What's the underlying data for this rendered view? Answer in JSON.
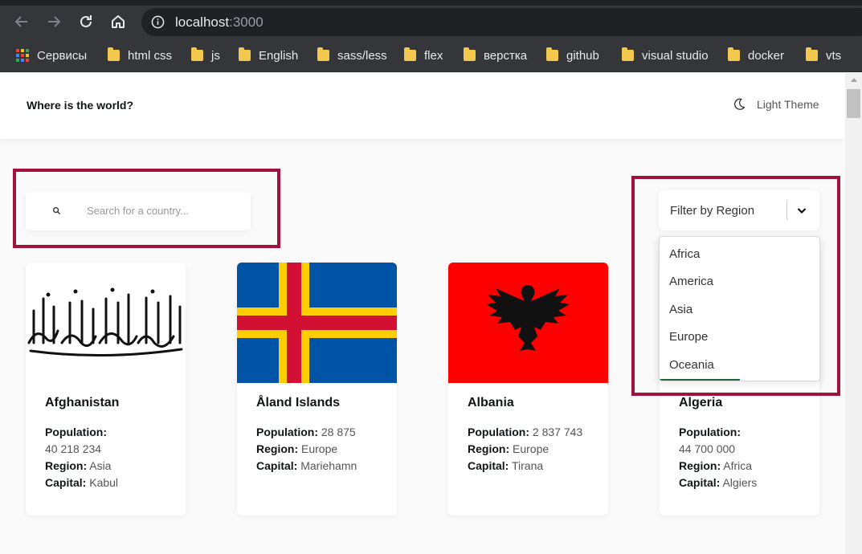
{
  "browser": {
    "url_host": "localhost",
    "url_port": ":3000",
    "bookmarks": [
      {
        "label": "Сервисы",
        "icon": "apps-grid-icon"
      },
      {
        "label": "html css",
        "icon": "folder-icon"
      },
      {
        "label": "js",
        "icon": "folder-icon"
      },
      {
        "label": "English",
        "icon": "folder-icon"
      },
      {
        "label": "sass/less",
        "icon": "folder-icon"
      },
      {
        "label": "flex",
        "icon": "folder-icon"
      },
      {
        "label": "верстка",
        "icon": "folder-icon"
      },
      {
        "label": "github",
        "icon": "folder-icon"
      },
      {
        "label": "visual studio",
        "icon": "folder-icon"
      },
      {
        "label": "docker",
        "icon": "folder-icon"
      },
      {
        "label": "vts",
        "icon": "folder-icon"
      }
    ]
  },
  "header": {
    "title": "Where is the world?",
    "theme_label": "Light Theme"
  },
  "search": {
    "placeholder": "Search for a country..."
  },
  "filter": {
    "label": "Filter by Region",
    "options": [
      "Africa",
      "America",
      "Asia",
      "Europe",
      "Oceania"
    ]
  },
  "labels": {
    "population": "Population:",
    "region": "Region:",
    "capital": "Capital:"
  },
  "countries": [
    {
      "name": "Afghanistan",
      "population": "40 218 234",
      "region": "Asia",
      "capital": "Kabul"
    },
    {
      "name": "Åland Islands",
      "population": "28 875",
      "region": "Europe",
      "capital": "Mariehamn"
    },
    {
      "name": "Albania",
      "population": "2 837 743",
      "region": "Europe",
      "capital": "Tirana"
    },
    {
      "name": "Algeria",
      "population": "44 700 000",
      "region": "Africa",
      "capital": "Algiers"
    }
  ],
  "colors": {
    "highlight": "#a2123d",
    "aland_blue": "#0053a5",
    "aland_yellow": "#ffce00",
    "aland_red": "#d21034",
    "albania_red": "#ff0000"
  }
}
